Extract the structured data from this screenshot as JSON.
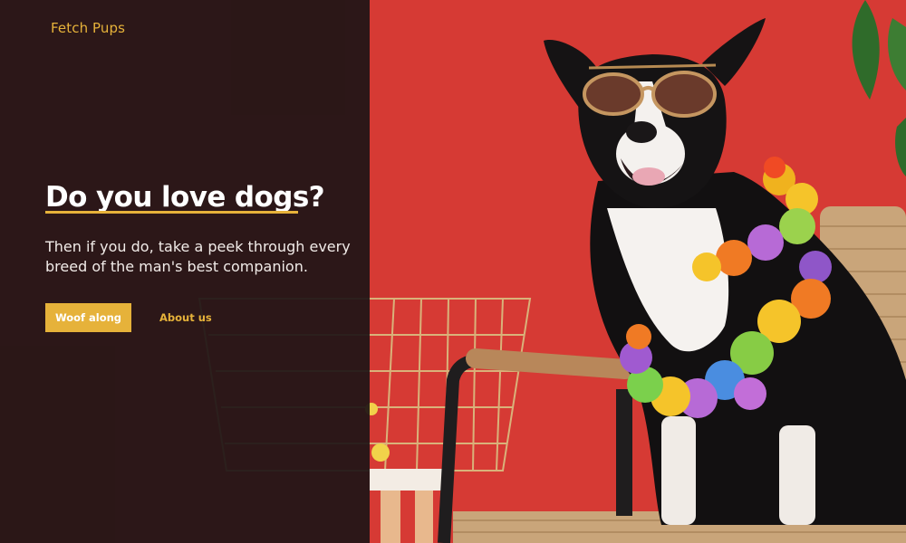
{
  "brand": {
    "name": "Fetch Pups"
  },
  "hero": {
    "headline": "Do you love dogs?",
    "subtitle": "Then if you do, take a peek through every breed of the man's best companion.",
    "primary_cta": "Woof along",
    "secondary_cta": "About us",
    "image_icon": "dog-with-sunglasses-and-flower-lei-photo"
  },
  "colors": {
    "accent": "#e6b23a",
    "panel": "#1e1415",
    "wall": "#d63a35",
    "heading_text": "#ffffff"
  }
}
